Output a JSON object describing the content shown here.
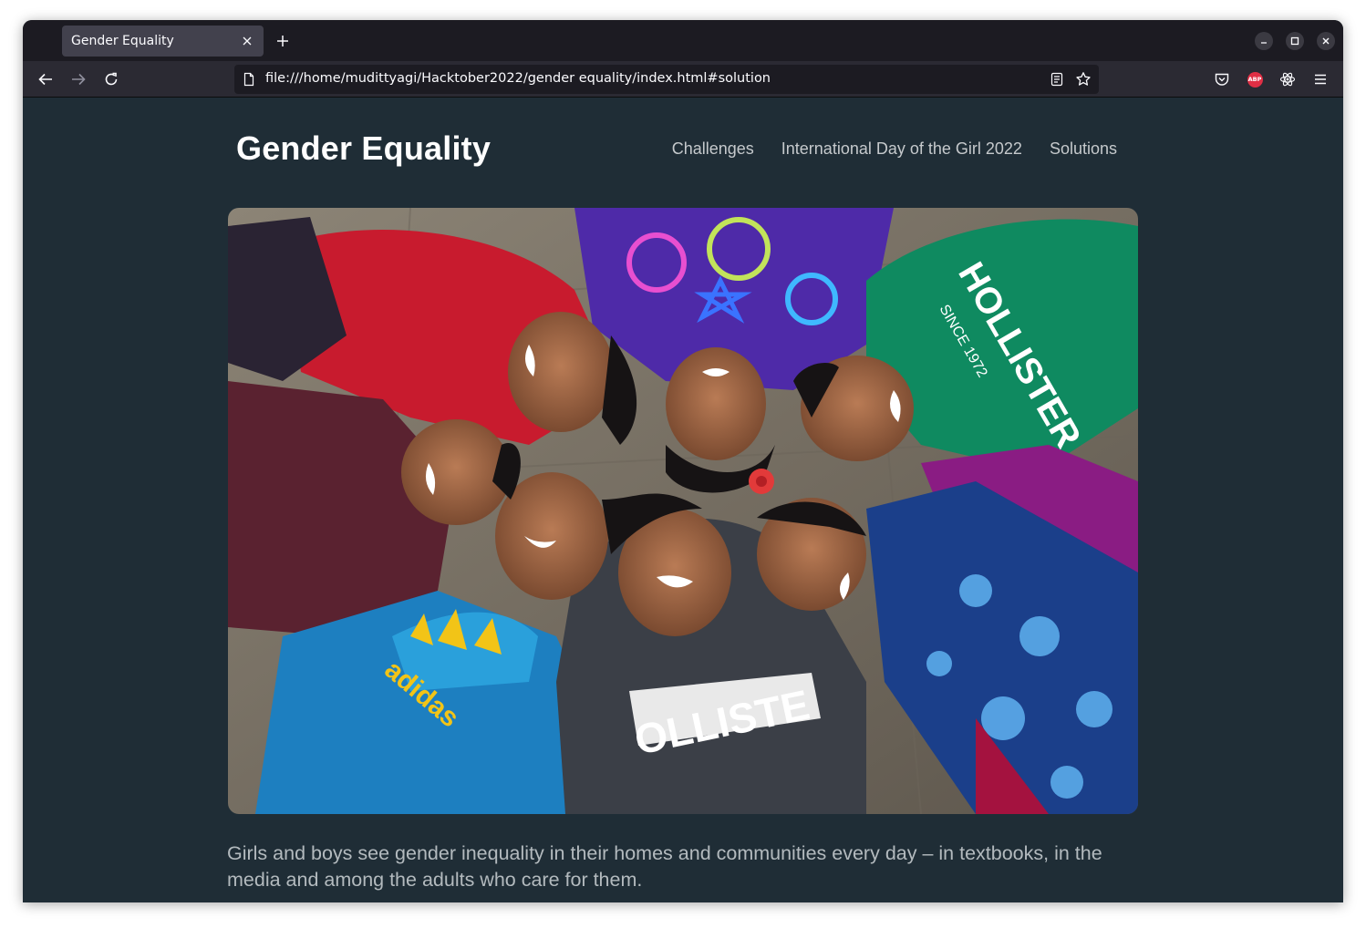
{
  "browser": {
    "tab": {
      "title": "Gender Equality"
    },
    "address": {
      "url": "file:///home/mudittyagi/Hacktober2022/gender equality/index.html#solution"
    },
    "extensions": {
      "adblock_badge": "ABP"
    }
  },
  "site": {
    "title": "Gender Equality",
    "nav": [
      "Challenges",
      "International Day of the Girl 2022",
      "Solutions"
    ]
  },
  "hero": {
    "shirt_texts": [
      "adidas",
      "OLLISTE",
      "HOLLISTER",
      "SINCE 1972"
    ]
  },
  "body": {
    "lead": "Girls and boys see gender inequality in their homes and communities every day – in textbooks, in the media and among the adults who care for them."
  }
}
